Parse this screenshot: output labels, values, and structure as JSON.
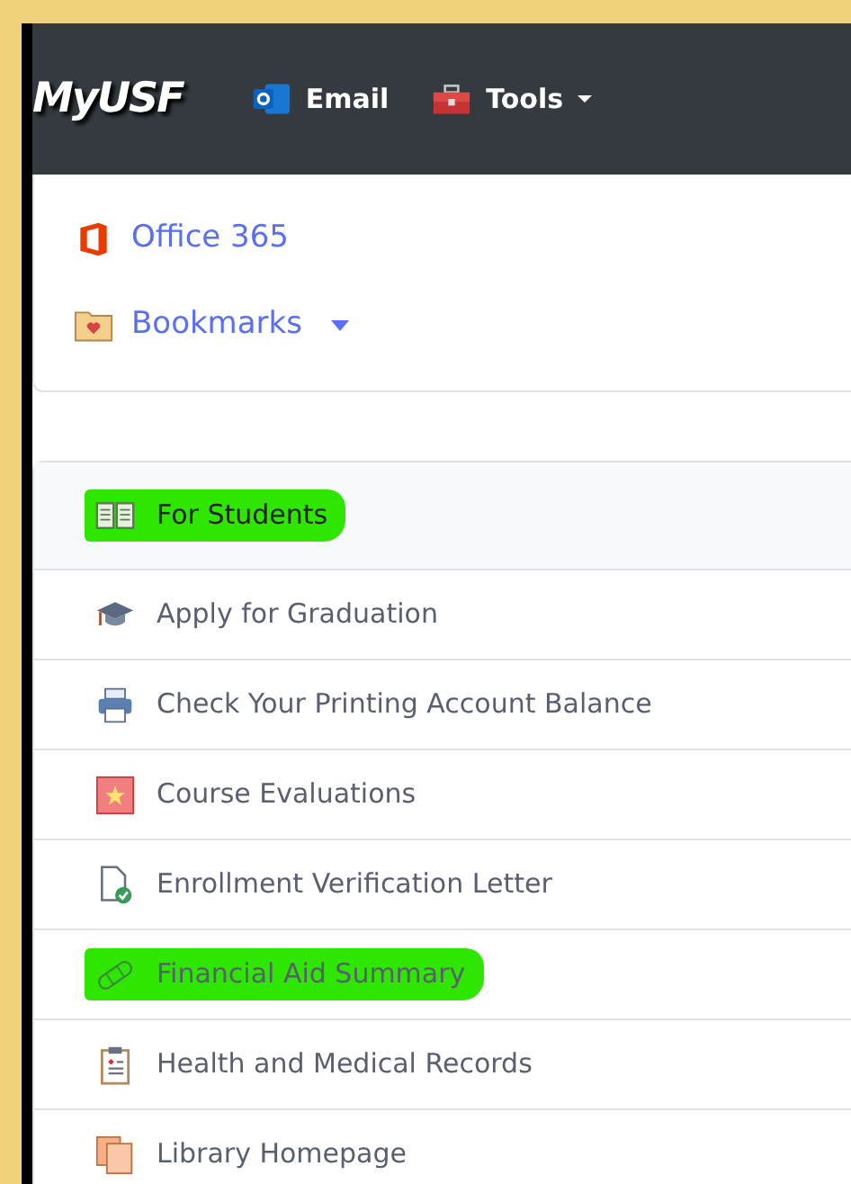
{
  "navbar": {
    "brand": "MyUSF",
    "links": [
      {
        "label": "Email",
        "dropdown": false
      },
      {
        "label": "Tools",
        "dropdown": true
      }
    ]
  },
  "quick_links": [
    {
      "label": "Office 365",
      "dropdown": false
    },
    {
      "label": "Bookmarks",
      "dropdown": true
    }
  ],
  "section": {
    "title": "For Students",
    "highlighted": true
  },
  "items": [
    {
      "label": "Apply for Graduation",
      "highlighted": false
    },
    {
      "label": "Check Your Printing Account Balance",
      "highlighted": false
    },
    {
      "label": "Course Evaluations",
      "highlighted": false
    },
    {
      "label": "Enrollment Verification Letter",
      "highlighted": false
    },
    {
      "label": "Financial Aid Summary",
      "highlighted": true
    },
    {
      "label": "Health and Medical Records",
      "highlighted": false
    },
    {
      "label": "Library Homepage",
      "highlighted": false
    }
  ]
}
